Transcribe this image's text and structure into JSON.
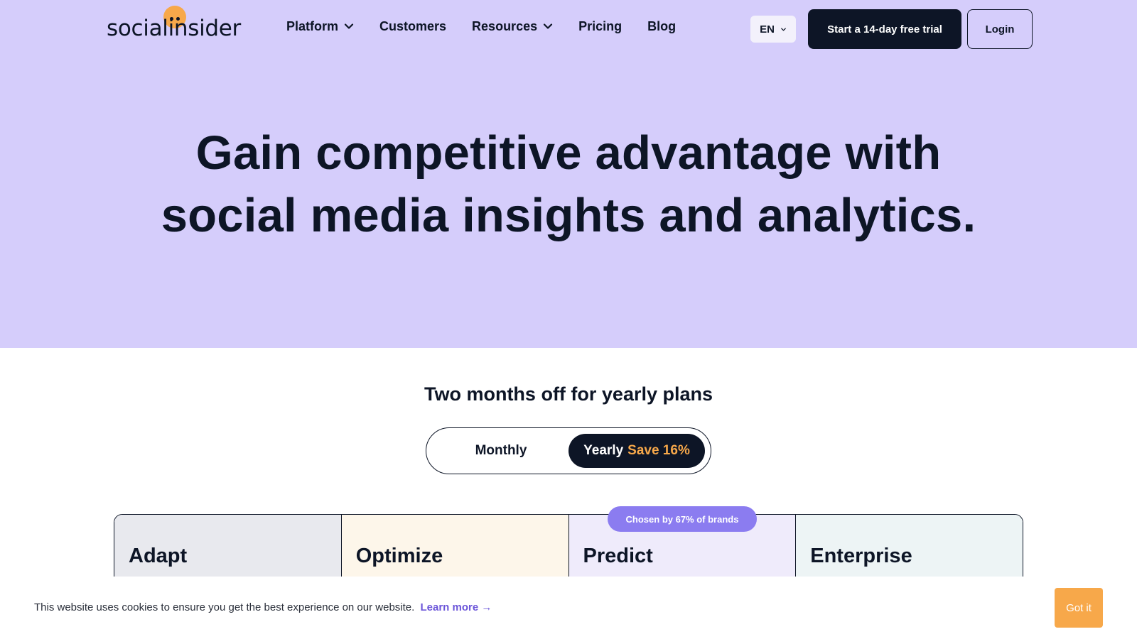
{
  "brand": {
    "logo_text": "socialinsider",
    "accent": "#f7a84a",
    "dark": "#0d1526",
    "hero_bg": "#d5cdfb"
  },
  "nav": {
    "items": [
      {
        "label": "Platform",
        "has_dropdown": true
      },
      {
        "label": "Customers",
        "has_dropdown": false
      },
      {
        "label": "Resources",
        "has_dropdown": true
      },
      {
        "label": "Pricing",
        "has_dropdown": false
      },
      {
        "label": "Blog",
        "has_dropdown": false
      }
    ],
    "language": "EN",
    "trial_button": "Start a 14-day free trial",
    "login_button": "Login"
  },
  "hero": {
    "title_line1": "Gain competitive advantage with",
    "title_line2": "social media insights and analytics."
  },
  "pricing": {
    "heading": "Two months off for yearly plans",
    "toggle": {
      "monthly": "Monthly",
      "yearly": "Yearly",
      "save": "Save 16%",
      "selected": "Yearly"
    },
    "chosen_badge": "Chosen by 67% of brands",
    "plans": [
      {
        "name": "Adapt",
        "bg": "#e8e9ee"
      },
      {
        "name": "Optimize",
        "bg": "#fdf6ea"
      },
      {
        "name": "Predict",
        "bg": "#efebfb"
      },
      {
        "name": "Enterprise",
        "bg": "#edf4f5"
      }
    ]
  },
  "cookie": {
    "text": "This website uses cookies to ensure you get the best experience on our website.",
    "learn_more": "Learn more →",
    "button": "Got it"
  }
}
